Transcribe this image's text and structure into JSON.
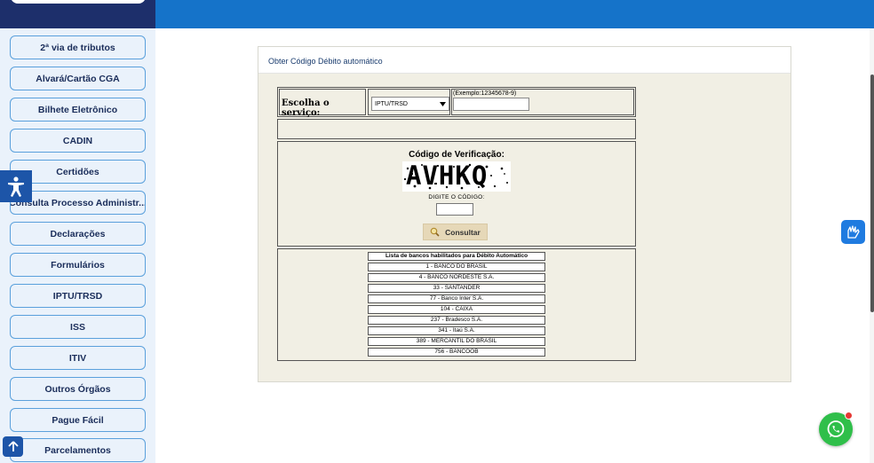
{
  "sidebar": {
    "items": [
      {
        "label": "2ª via de tributos"
      },
      {
        "label": "Alvará/Cartão CGA"
      },
      {
        "label": "Bilhete Eletrônico"
      },
      {
        "label": "CADIN"
      },
      {
        "label": "Certidões"
      },
      {
        "label": "Consulta Processo Administr..."
      },
      {
        "label": "Declarações"
      },
      {
        "label": "Formulários"
      },
      {
        "label": "IPTU/TRSD"
      },
      {
        "label": "ISS"
      },
      {
        "label": "ITIV"
      },
      {
        "label": "Outros Órgãos"
      },
      {
        "label": "Pague Fácil"
      },
      {
        "label": "Parcelamentos"
      }
    ]
  },
  "panel": {
    "title": "Obter Código Débito automático",
    "service_label": "Escolha o serviço:",
    "service_selected": "IPTU/TRSD",
    "example_label": "(Exemplo:12345678-9)",
    "code_value": "",
    "verification_title": "Código de Verificação:",
    "captcha_text": "AVHKQ",
    "digite_label": "DIGITE O CÓDIGO:",
    "digite_value": "",
    "consultar_label": "Consultar"
  },
  "banks": {
    "title": "Lista de bancos habilitados para Débito Automático",
    "items": [
      "1 - BANCO DO BRASIL",
      "4 - BANCO NORDESTE S.A.",
      "33 - SANTANDER",
      "77 - Banco Inter S.A.",
      "104 - CAIXA",
      "237 - Bradesco S.A.",
      "341 - Itaú S.A.",
      "389 - MERCANTIL DO BRASIL",
      "756 - BANCOOB"
    ]
  },
  "colors": {
    "topbar": "#1573c9",
    "topbar_left": "#1d2f6b",
    "sidebar_bg": "#eaf2fb",
    "sidebar_border": "#5aa0dc",
    "panel_bg": "#f1efe4",
    "whatsapp": "#2fbf4a"
  }
}
